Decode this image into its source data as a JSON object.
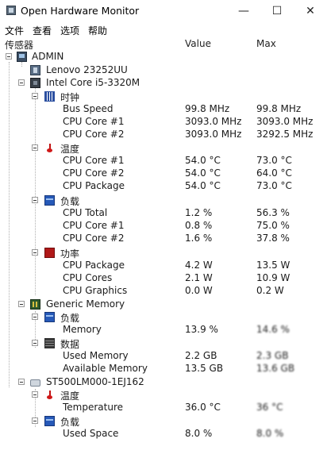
{
  "window": {
    "title": "Open Hardware Monitor",
    "minimize": "—",
    "maximize": "☐",
    "close": "✕"
  },
  "menu": [
    "文件",
    "查看",
    "选项",
    "帮助"
  ],
  "columns": {
    "sensor": "传感器",
    "value": "Value",
    "max": "Max"
  },
  "tree": {
    "root": "ADMIN",
    "mainboard": "Lenovo 23252UU",
    "cpu": {
      "name": "Intel Core i5-3320M",
      "clocks": {
        "label": "时钟",
        "rows": [
          {
            "name": "Bus Speed",
            "value": "99.8 MHz",
            "max": "99.8 MHz"
          },
          {
            "name": "CPU Core #1",
            "value": "3093.0 MHz",
            "max": "3093.0 MHz"
          },
          {
            "name": "CPU Core #2",
            "value": "3093.0 MHz",
            "max": "3292.5 MHz"
          }
        ]
      },
      "temps": {
        "label": "温度",
        "rows": [
          {
            "name": "CPU Core #1",
            "value": "54.0 °C",
            "max": "73.0 °C"
          },
          {
            "name": "CPU Core #2",
            "value": "54.0 °C",
            "max": "64.0 °C"
          },
          {
            "name": "CPU Package",
            "value": "54.0 °C",
            "max": "73.0 °C"
          }
        ]
      },
      "load": {
        "label": "负载",
        "rows": [
          {
            "name": "CPU Total",
            "value": "1.2 %",
            "max": "56.3 %"
          },
          {
            "name": "CPU Core #1",
            "value": "0.8 %",
            "max": "75.0 %"
          },
          {
            "name": "CPU Core #2",
            "value": "1.6 %",
            "max": "37.8 %"
          }
        ]
      },
      "power": {
        "label": "功率",
        "rows": [
          {
            "name": "CPU Package",
            "value": "4.2 W",
            "max": "13.5 W"
          },
          {
            "name": "CPU Cores",
            "value": "2.1 W",
            "max": "10.9 W"
          },
          {
            "name": "CPU Graphics",
            "value": "0.0 W",
            "max": "0.2 W"
          }
        ]
      }
    },
    "memory": {
      "name": "Generic Memory",
      "load": {
        "label": "负载",
        "rows": [
          {
            "name": "Memory",
            "value": "13.9 %",
            "max": "14.6 %"
          }
        ]
      },
      "data": {
        "label": "数据",
        "rows": [
          {
            "name": "Used Memory",
            "value": "2.2 GB",
            "max": "2.3 GB"
          },
          {
            "name": "Available Memory",
            "value": "13.5 GB",
            "max": "13.6 GB"
          }
        ]
      }
    },
    "hdd": {
      "name": "ST500LM000-1EJ162",
      "temps": {
        "label": "温度",
        "rows": [
          {
            "name": "Temperature",
            "value": "36.0 °C",
            "max": "36 °C"
          }
        ]
      },
      "load": {
        "label": "负载",
        "rows": [
          {
            "name": "Used Space",
            "value": "8.0 %",
            "max": "8.0 %"
          }
        ]
      }
    }
  }
}
